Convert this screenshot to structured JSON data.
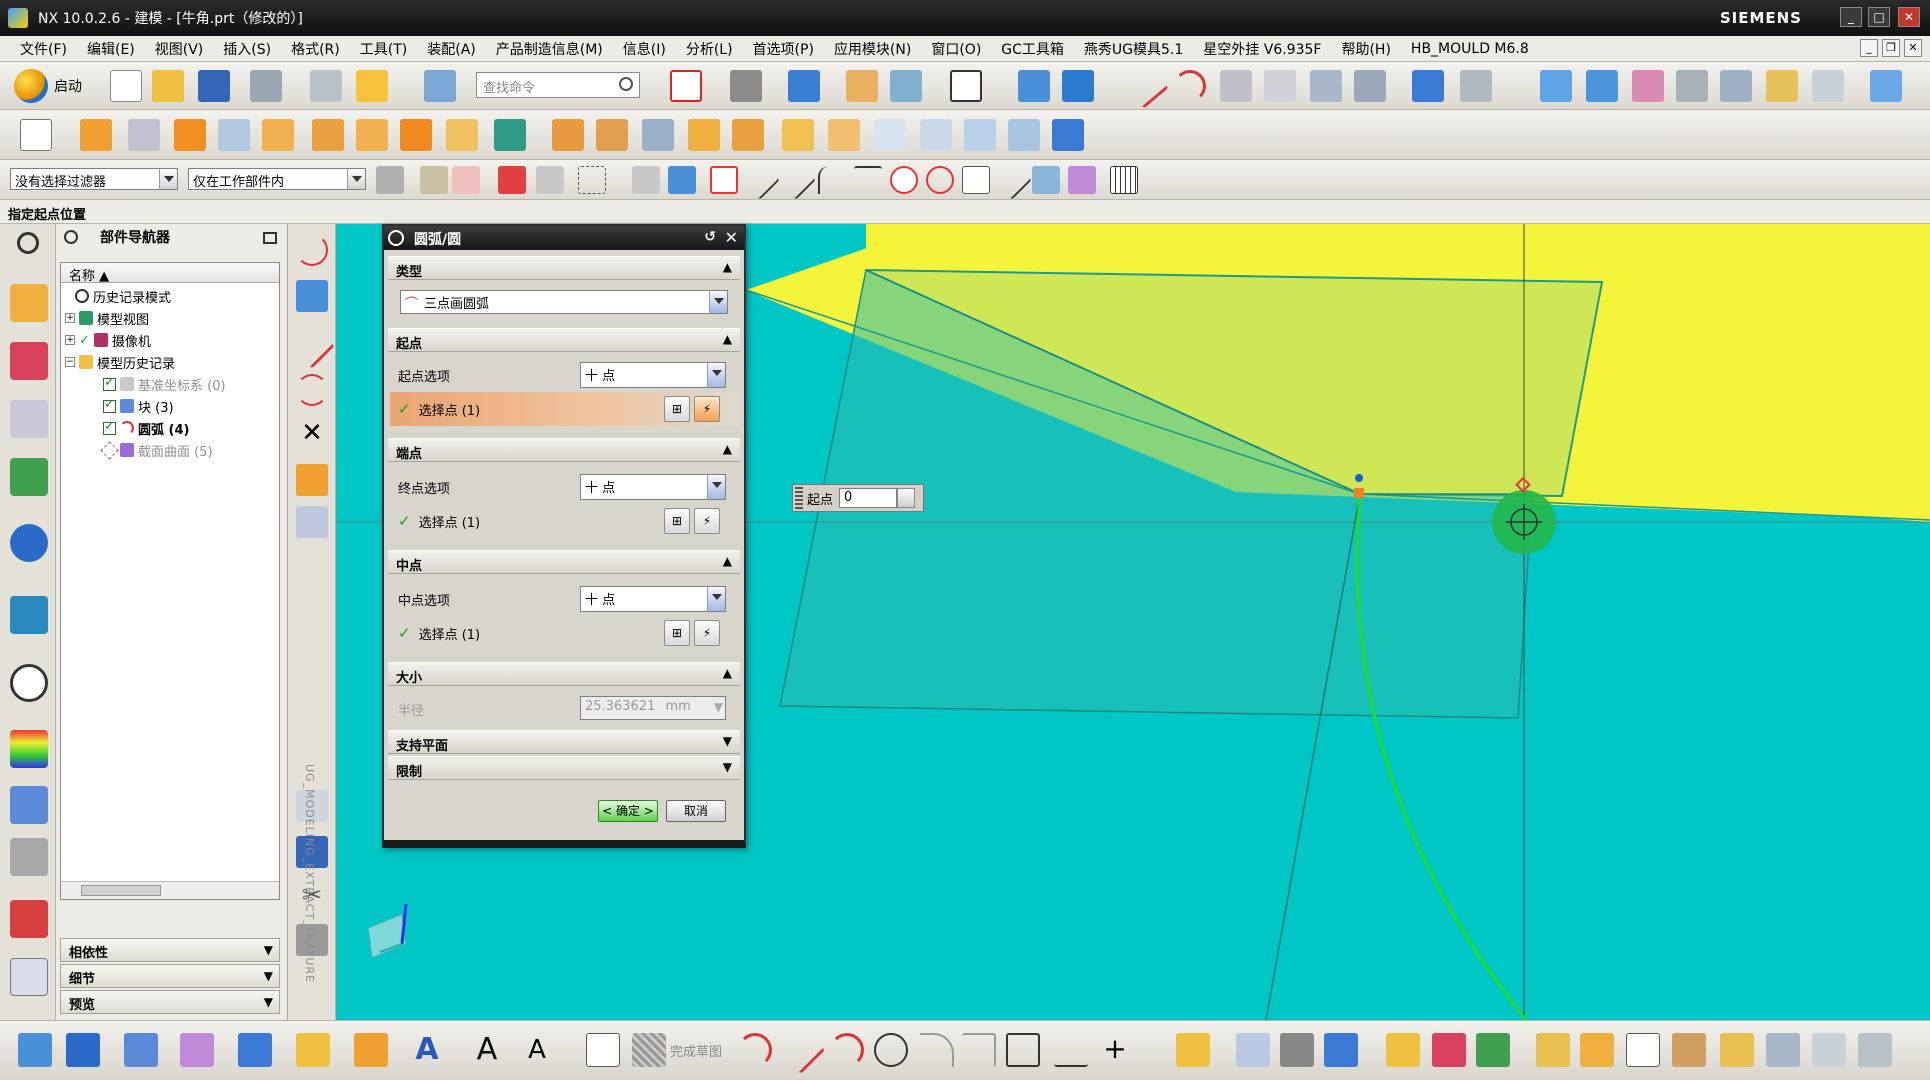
{
  "window": {
    "title": "NX 10.0.2.6 - 建模 - [牛角.prt（修改的）]",
    "brand": "SIEMENS",
    "controls": [
      "_",
      "□",
      "✕"
    ]
  },
  "menu": {
    "items": [
      "文件(F)",
      "编辑(E)",
      "视图(V)",
      "插入(S)",
      "格式(R)",
      "工具(T)",
      "装配(A)",
      "产品制造信息(M)",
      "信息(I)",
      "分析(L)",
      "首选项(P)",
      "应用模块(N)",
      "窗口(O)",
      "GC工具箱",
      "燕秀UG模具5.1",
      "星空外挂 V6.935F",
      "帮助(H)",
      "HB_MOULD M6.8"
    ]
  },
  "toolbar": {
    "start_label": "启动",
    "search_placeholder": "查找命令",
    "filter_value": "没有选择过滤器",
    "scope_value": "仅在工作部件内"
  },
  "cue": {
    "text": "指定起点位置"
  },
  "navigator": {
    "title": "部件导航器",
    "column_name": "名称",
    "items": [
      {
        "label": "历史记录模式"
      },
      {
        "label": "模型视图"
      },
      {
        "label": "摄像机"
      },
      {
        "label": "模型历史记录"
      },
      {
        "label": "基准坐标系 (0)"
      },
      {
        "label": "块 (3)"
      },
      {
        "label": "圆弧 (4)"
      },
      {
        "label": "截面曲面 (5)"
      }
    ],
    "sections": [
      "相依性",
      "细节",
      "预览"
    ]
  },
  "vertical_toolbar": {
    "label": "UG_MODELING_EXTRACT_FEATURE"
  },
  "dialog": {
    "title": "圆弧/圆",
    "type_group": "类型",
    "type_value": "三点画圆弧",
    "start_group": "起点",
    "start_option_label": "起点选项",
    "start_option_value": "十 点",
    "start_select": "选择点 (1)",
    "end_group": "端点",
    "end_option_label": "终点选项",
    "end_option_value": "十 点",
    "end_select": "选择点 (1)",
    "mid_group": "中点",
    "mid_option_label": "中点选项",
    "mid_option_value": "十 点",
    "mid_select": "选择点 (1)",
    "size_group": "大小",
    "radius_label": "半径",
    "radius_value": "25.363621",
    "radius_unit": "mm",
    "support_group": "支持平面",
    "limits_group": "限制",
    "ok_label": "< 确定 >",
    "cancel_label": "取消"
  },
  "start_input": {
    "label": "起点",
    "value": "0"
  },
  "bottom_toolbar": {
    "finish_sketch_label": "完成草图"
  },
  "colors": {
    "viewport_bg": "#00c6c6",
    "yellow_face": "#f4f43a",
    "arc_green": "#22dd22",
    "dialog_active": "#e9a572"
  }
}
